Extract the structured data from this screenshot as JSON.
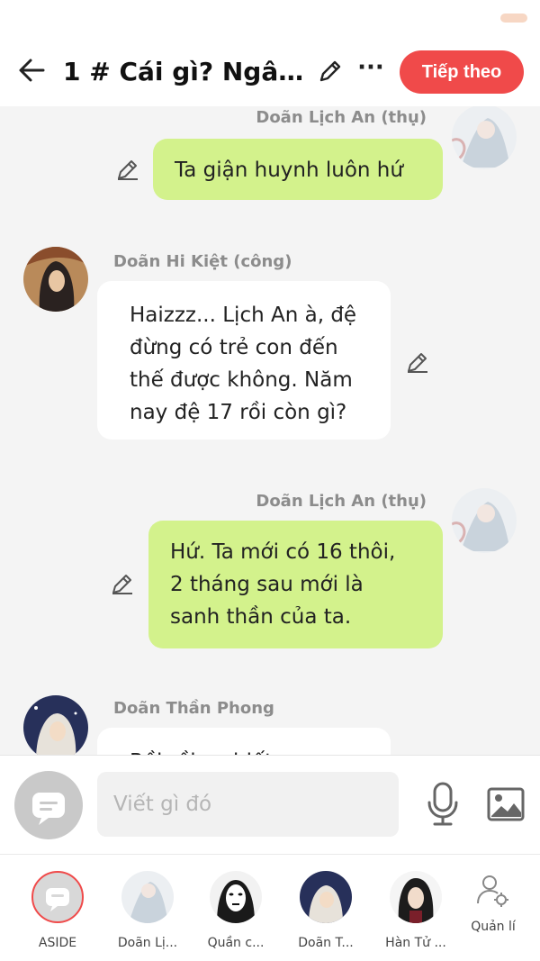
{
  "header": {
    "title": "1 # Cái gì? Ngâ...",
    "next_label": "Tiếp theo",
    "more_label": "···"
  },
  "messages": [
    {
      "sender": "Doãn Lịch An (thụ)",
      "side": "right",
      "text": "Ta giận huynh luôn hứ"
    },
    {
      "sender": "Doãn Hi Kiệt (công)",
      "side": "left",
      "lines": [
        "Haizzz... Lịch An à, đệ",
        "đừng có trẻ con đến",
        "thế được không. Năm",
        "nay đệ 17 rồi còn gì?"
      ]
    },
    {
      "sender": "Doãn Lịch An (thụ)",
      "side": "right",
      "lines": [
        "Hứ. Ta mới có 16 thôi,",
        "2 tháng sau mới là",
        "sanh thần của ta."
      ]
    },
    {
      "sender": "Doãn Thần Phong",
      "side": "left",
      "text": "Rồi rồi ca biết"
    }
  ],
  "composer": {
    "placeholder": "Viết gì đó"
  },
  "characters": [
    {
      "label": "ASIDE"
    },
    {
      "label": "Doãn Lị..."
    },
    {
      "label": "Quần c..."
    },
    {
      "label": "Doãn T..."
    },
    {
      "label": "Hàn Tử ..."
    },
    {
      "label": "Quản lí"
    }
  ],
  "colors": {
    "accent": "#f04a4a",
    "right_bubble": "#d3f28c",
    "left_bubble": "#ffffff",
    "background": "#f4f4f4"
  }
}
